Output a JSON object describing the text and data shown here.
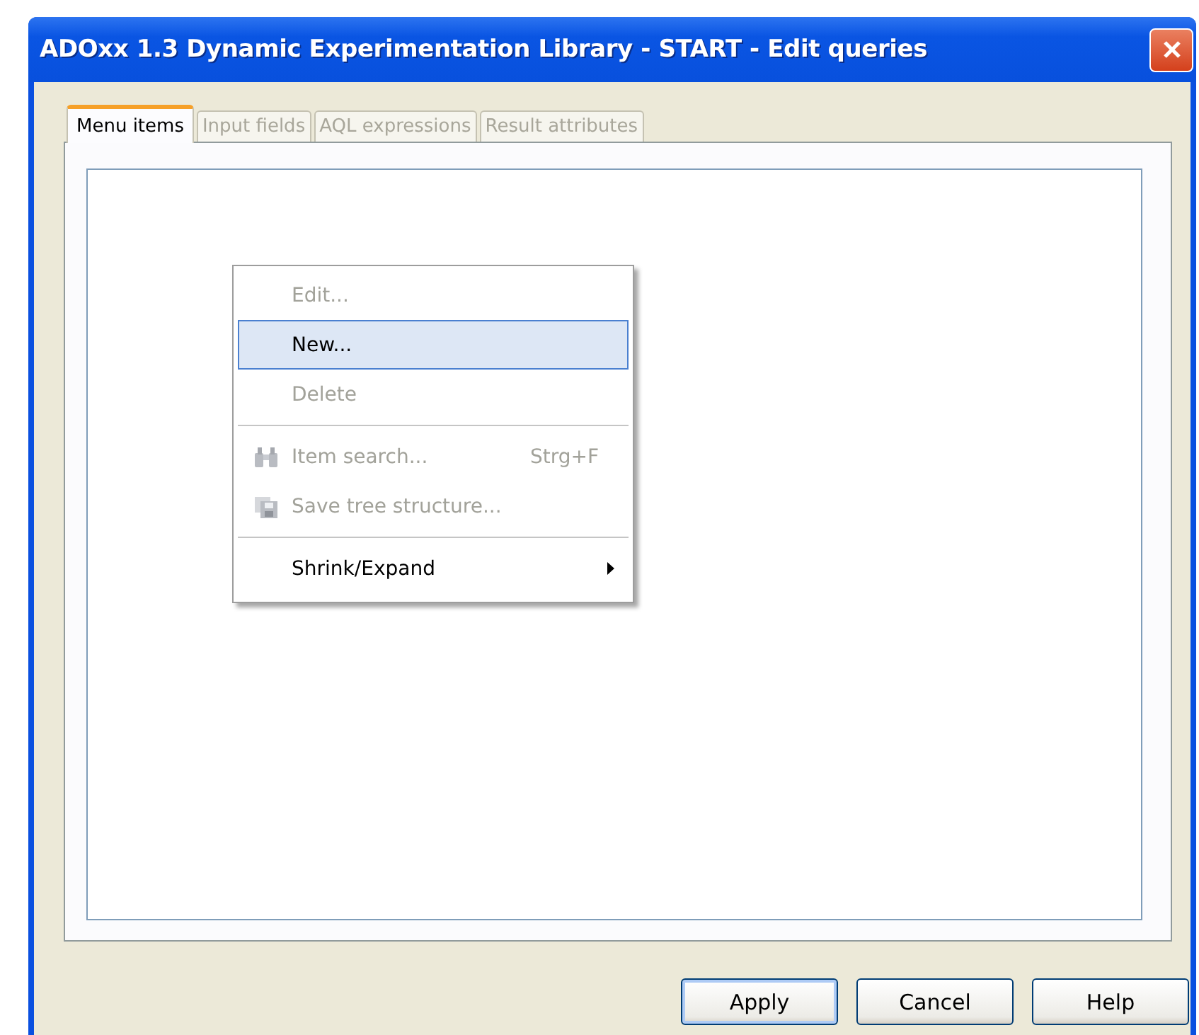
{
  "window": {
    "title": "ADOxx 1.3 Dynamic Experimentation Library - START - Edit queries"
  },
  "tabs": [
    {
      "label": "Menu items",
      "selected": true,
      "disabled": false
    },
    {
      "label": "Input fields",
      "selected": false,
      "disabled": true
    },
    {
      "label": "AQL expressions",
      "selected": false,
      "disabled": true
    },
    {
      "label": "Result attributes",
      "selected": false,
      "disabled": true
    }
  ],
  "context_menu": {
    "items": [
      {
        "kind": "item",
        "label": "Edit...",
        "disabled": true,
        "highlighted": false
      },
      {
        "kind": "item",
        "label": "New...",
        "disabled": false,
        "highlighted": true
      },
      {
        "kind": "item",
        "label": "Delete",
        "disabled": true,
        "highlighted": false
      },
      {
        "kind": "separator"
      },
      {
        "kind": "icon-item",
        "label": "Item search...",
        "shortcut": "Strg+F",
        "disabled": true,
        "highlighted": false
      },
      {
        "kind": "icon-item",
        "label": "Save tree structure...",
        "disabled": true,
        "highlighted": false
      },
      {
        "kind": "separator"
      },
      {
        "kind": "submenu",
        "label": "Shrink/Expand",
        "disabled": false,
        "highlighted": false
      }
    ]
  },
  "buttons": [
    {
      "label": "Apply",
      "default": true
    },
    {
      "label": "Cancel",
      "default": false
    },
    {
      "label": "Help",
      "default": false
    }
  ]
}
